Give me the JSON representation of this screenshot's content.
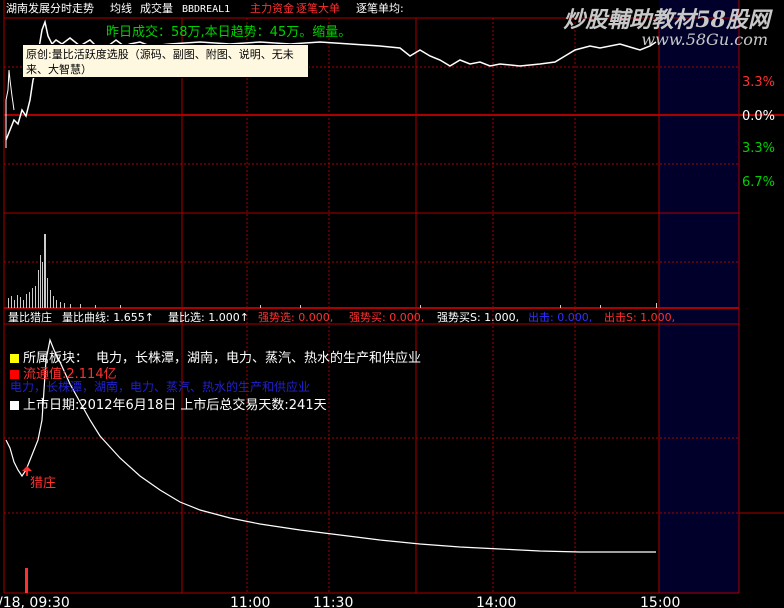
{
  "header": {
    "title": "湖南发展分时走势",
    "items": [
      {
        "label": "均线",
        "color": "#ffffff"
      },
      {
        "label": "成交量",
        "color": "#ffffff"
      },
      {
        "label": "BBDREAL1",
        "color": "#ffffff"
      },
      {
        "label": "主力资金",
        "color": "#ff3030"
      },
      {
        "label": "逐笔大单",
        "color": "#ff3030"
      },
      {
        "label": "逐笔单均:",
        "color": "#ffffff"
      }
    ],
    "volume_note": "昨日成交：58万,本日趋势：45万。缩量。"
  },
  "watermark": {
    "line1": "炒股輔助教材58股网",
    "line2": "www.58Gu.com"
  },
  "tooltip": {
    "text": "原创:量比活跃度选股（源码、副图、附图、说明、无未来、大智慧）"
  },
  "price_axis": {
    "labels": [
      "3.3%",
      "0.0%",
      "3.3%",
      "6.7%"
    ],
    "colors": [
      "#ff3030",
      "#ffffff",
      "#00d000",
      "#00d000"
    ]
  },
  "indicator_bar": {
    "items": [
      {
        "label": "量比猎庄",
        "color": "#ffffff"
      },
      {
        "label": "量比曲线: 1.655↑",
        "color": "#ffffff"
      },
      {
        "label": "量比选: 1.000↑",
        "color": "#ffffff"
      },
      {
        "label": "强势选: 0.000,",
        "color": "#ff3030"
      },
      {
        "label": "强势买: 0.000,",
        "color": "#ff3030"
      },
      {
        "label": "强势买S: 1.000,",
        "color": "#ffffff"
      },
      {
        "label": "出击: 0.000,",
        "color": "#3030ff"
      },
      {
        "label": "出击S: 1.000,",
        "color": "#ff3030"
      }
    ]
  },
  "info": {
    "sector_label": "所属板块：",
    "sector_value": "电力，长株潭，湖南，电力、蒸汽、热水的生产和供应业",
    "cap_line": "流通值:2.114亿",
    "dup_line": "电力，长株潭，湖南，电力、蒸汽、热水的生产和供应业",
    "listing_line": "上市日期:2012年6月18日  上市后总交易天数:241天"
  },
  "markers": {
    "zhuang": "猎庄"
  },
  "time_axis": {
    "labels": [
      "/18, 09:30",
      "11:00",
      "11:30",
      "14:00",
      "15:00"
    ]
  },
  "colors": {
    "grid": "#aa0000",
    "price_line": "#ffffff",
    "panel_right": "#00002a"
  }
}
